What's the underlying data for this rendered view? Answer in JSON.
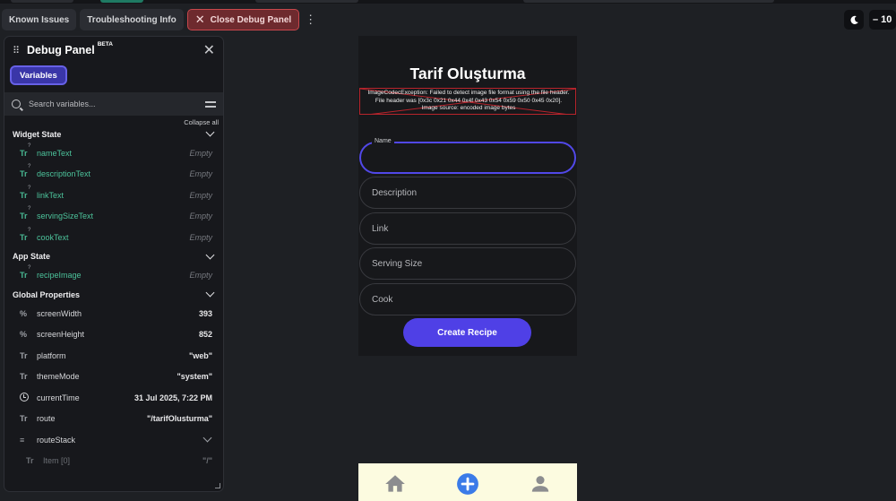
{
  "toolbar": {
    "known_issues": "Known Issues",
    "troubleshooting": "Troubleshooting Info",
    "close_debug": "Close Debug Panel",
    "zoom_label": "10"
  },
  "panel": {
    "title": "Debug Panel",
    "badge": "BETA",
    "variables_tab": "Variables",
    "search_placeholder": "Search variables...",
    "collapse_all": "Collapse all",
    "widget_state": {
      "title": "Widget State",
      "rows": [
        {
          "name": "nameText",
          "value": "Empty"
        },
        {
          "name": "descriptionText",
          "value": "Empty"
        },
        {
          "name": "linkText",
          "value": "Empty"
        },
        {
          "name": "servingSizeText",
          "value": "Empty"
        },
        {
          "name": "cookText",
          "value": "Empty"
        }
      ]
    },
    "app_state": {
      "title": "App State",
      "rows": [
        {
          "name": "recipeImage",
          "value": "Empty"
        }
      ]
    },
    "global_properties": {
      "title": "Global Properties",
      "rows": [
        {
          "icon": "%",
          "name": "screenWidth",
          "value": "393"
        },
        {
          "icon": "%",
          "name": "screenHeight",
          "value": "852"
        },
        {
          "icon": "Tr",
          "name": "platform",
          "value": "\"web\""
        },
        {
          "icon": "Tr",
          "name": "themeMode",
          "value": "\"system\""
        },
        {
          "icon": "clock",
          "name": "currentTime",
          "value": "31 Jul 2025, 7:22 PM"
        },
        {
          "icon": "Tr",
          "name": "route",
          "value": "\"/tarifOlusturma\""
        },
        {
          "icon": "≡",
          "name": "routeStack",
          "value": ""
        },
        {
          "icon": "Tr",
          "name": "Item [0]",
          "value": "\"/\""
        }
      ]
    }
  },
  "phone": {
    "title": "Tarif Oluşturma",
    "error_line1": "ImageCodecException: Failed to detect image file format using the file header.",
    "error_line2": "File header was [0x3c 0x21 0x44 0x4f 0x43 0x54 0x59 0x50 0x45 0x20].",
    "error_line3": "Image source: encoded image bytes",
    "fields": {
      "name_label": "Name",
      "description": "Description",
      "link": "Link",
      "serving_size": "Serving Size",
      "cook": "Cook"
    },
    "create_button": "Create Recipe"
  },
  "navbar": {
    "items": [
      "home-icon",
      "add-circle-icon",
      "person-icon"
    ],
    "accent": "#3b7be8",
    "icon_color": "#8c8d8f"
  },
  "colors": {
    "accent_purple": "#4f40e6",
    "state_green": "#4cc39b",
    "error_red": "#b8242c"
  }
}
